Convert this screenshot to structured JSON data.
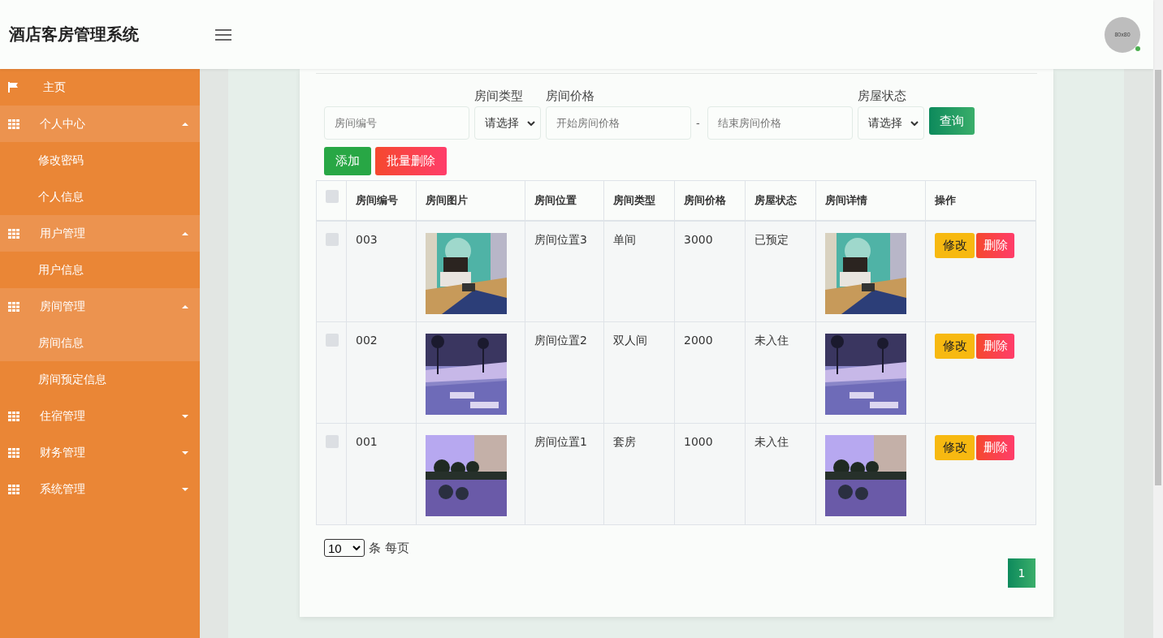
{
  "header": {
    "title": "酒店客房管理系统",
    "avatar_text": "80x80",
    "online": true
  },
  "sidebar": {
    "items": [
      {
        "kind": "home",
        "label": "主页",
        "selected": false
      },
      {
        "kind": "group",
        "label": "个人中心",
        "expanded": true,
        "children": [
          {
            "label": "修改密码",
            "selected": false
          },
          {
            "label": "个人信息",
            "selected": false
          }
        ]
      },
      {
        "kind": "group",
        "label": "用户管理",
        "expanded": true,
        "children": [
          {
            "label": "用户信息",
            "selected": false
          }
        ]
      },
      {
        "kind": "group",
        "label": "房间管理",
        "expanded": true,
        "children": [
          {
            "label": "房间信息",
            "selected": true
          },
          {
            "label": "房间预定信息",
            "selected": false
          }
        ]
      },
      {
        "kind": "group",
        "label": "住宿管理",
        "expanded": false
      },
      {
        "kind": "group",
        "label": "财务管理",
        "expanded": false
      },
      {
        "kind": "group",
        "label": "系统管理",
        "expanded": false
      }
    ]
  },
  "search": {
    "room_no": {
      "placeholder": "房间编号"
    },
    "room_type": {
      "label": "房间类型",
      "value": "请选择"
    },
    "price": {
      "label": "房间价格",
      "from_placeholder": "开始房间价格",
      "separator": "-",
      "to_placeholder": "结束房间价格"
    },
    "status": {
      "label": "房屋状态",
      "value": "请选择"
    },
    "query_button": "查询"
  },
  "actions": [
    "添加",
    "批量删除"
  ],
  "table": {
    "header_checked": false,
    "columns": [
      "房间编号",
      "房间图片",
      "房间位置",
      "房间类型",
      "房间价格",
      "房屋状态",
      "房间详情",
      "操作"
    ],
    "rows": [
      {
        "checked": false,
        "room_no": "003",
        "location": "房间位置3",
        "type": "单间",
        "price": "3000",
        "status": "已预定",
        "edit": "修改",
        "delete": "删除"
      },
      {
        "checked": false,
        "room_no": "002",
        "location": "房间位置2",
        "type": "双人间",
        "price": "2000",
        "status": "未入住",
        "edit": "修改",
        "delete": "删除"
      },
      {
        "checked": false,
        "room_no": "001",
        "location": "房间位置1",
        "type": "套房",
        "price": "1000",
        "status": "未入住",
        "edit": "修改",
        "delete": "删除"
      }
    ]
  },
  "pagination": {
    "page_size": "10",
    "page_size_suffix": "条 每页",
    "pages": [
      {
        "label": "1",
        "selected": true
      }
    ]
  }
}
